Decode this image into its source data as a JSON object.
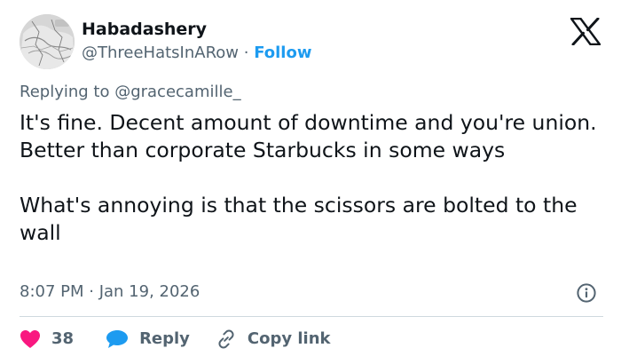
{
  "author": {
    "display_name": "Habadashery",
    "handle": "@ThreeHatsInARow",
    "separator": " · ",
    "follow_label": "Follow"
  },
  "reply_to": "Replying to @gracecamille_",
  "tweet": {
    "paragraphs": [
      "It's fine. Decent amount of downtime and you're union. Better than corporate Starbucks in some ways",
      "What's annoying is that the scissors are bolted to the wall"
    ],
    "timestamp": "8:07 PM · Jan 19, 2026"
  },
  "actions": {
    "like_count": "38",
    "reply_label": "Reply",
    "copy_link_label": "Copy link"
  },
  "colors": {
    "accent": "#1d9bf0",
    "like": "#f91880",
    "secondary_text": "#536471"
  },
  "icons": {
    "brand": "x-logo-icon",
    "info": "info-icon",
    "like": "heart-icon",
    "reply": "speech-bubble-icon",
    "copy": "link-icon"
  }
}
